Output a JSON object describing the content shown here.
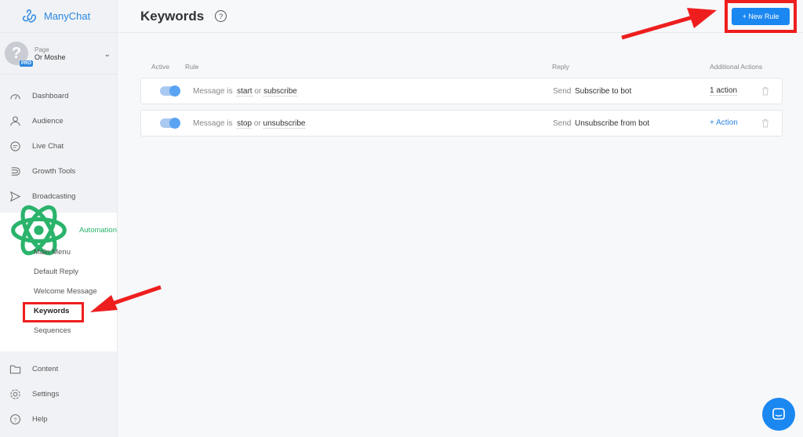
{
  "brand": {
    "name": "ManyChat"
  },
  "page_switch": {
    "label": "Page",
    "owner": "Or Moshe",
    "badge": "PRO",
    "avatar_glyph": "?"
  },
  "nav_top": [
    {
      "label": "Dashboard",
      "icon": "dashboard-icon"
    },
    {
      "label": "Audience",
      "icon": "audience-icon"
    },
    {
      "label": "Live Chat",
      "icon": "chat-icon"
    },
    {
      "label": "Growth Tools",
      "icon": "magnet-icon"
    },
    {
      "label": "Broadcasting",
      "icon": "send-icon"
    }
  ],
  "automation": {
    "label": "Automation",
    "sub_items": [
      "Main Menu",
      "Default Reply",
      "Welcome Message",
      "Keywords",
      "Sequences"
    ]
  },
  "nav_bottom": [
    {
      "label": "Content",
      "icon": "folder-icon"
    },
    {
      "label": "Settings",
      "icon": "gear-icon"
    },
    {
      "label": "Help",
      "icon": "help-icon"
    }
  ],
  "header": {
    "title": "Keywords",
    "new_rule": "+ New Rule"
  },
  "columns": {
    "active": "Active",
    "rule": "Rule",
    "reply": "Reply",
    "actions": "Additional Actions"
  },
  "rules": [
    {
      "prefix": "Message is",
      "kw1": "start",
      "or": "or",
      "kw2": "subscribe",
      "send": "Send",
      "reply": "Subscribe to bot",
      "action": "1 action",
      "active": true
    },
    {
      "prefix": "Message is",
      "kw1": "stop",
      "or": "or",
      "kw2": "unsubscribe",
      "send": "Send",
      "reply": "Unsubscribe from bot",
      "action": "+ Action",
      "active": true
    }
  ],
  "colors": {
    "accent": "#1b87f1",
    "automation": "#2ab36b",
    "highlight": "#ee1e1e"
  }
}
